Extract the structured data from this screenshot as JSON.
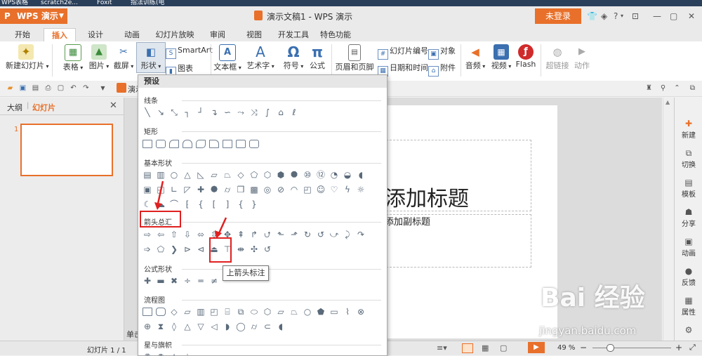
{
  "taskbar": {
    "items": [
      "WPS表格",
      "scratch2e...",
      "Foxit",
      "指法训练(电"
    ]
  },
  "app": {
    "name": "WPS 演示",
    "doc_title": "演示文稿1 - WPS 演示",
    "login": "未登录"
  },
  "tabs": [
    "开始",
    "插入",
    "设计",
    "动画",
    "幻灯片放映",
    "审阅",
    "视图",
    "开发工具",
    "特色功能"
  ],
  "ribbon": {
    "new_slide": "新建幻灯片",
    "table": "表格",
    "picture": "图片",
    "screenshot": "截屏",
    "shape": "形状",
    "smartart": "SmartArt",
    "chart": "图表",
    "textbox": "文本框",
    "wordart": "艺术字",
    "symbol": "符号",
    "formula": "公式",
    "header_footer": "页眉和页脚",
    "slide_number": "幻灯片编号",
    "object": "对象",
    "date_time": "日期和时间",
    "attachment": "附件",
    "audio": "音频",
    "video": "视频",
    "flash": "Flash",
    "hyperlink": "超链接",
    "action": "动作"
  },
  "quick_access": {
    "tab_label": "演示"
  },
  "left_panel": {
    "outline_tab": "大纲",
    "slides_tab": "幻灯片",
    "slide_num": "1"
  },
  "slide": {
    "title": "单击此处添加标题",
    "title_visible": "添加标题",
    "subtitle_visible": "添加副标题"
  },
  "right_sidebar": [
    "新建",
    "切换",
    "模板",
    "分享",
    "动画",
    "反馈",
    "属性"
  ],
  "status": {
    "slide_info": "幻灯片 1 / 1",
    "left_hint": "单击",
    "zoom": "49 %"
  },
  "dropdown": {
    "header": "预设",
    "categories": [
      "线条",
      "矩形",
      "基本形状",
      "箭头总汇",
      "公式形状",
      "流程图",
      "星与旗帜"
    ],
    "tooltip": "上箭头标注"
  },
  "watermark": {
    "text": "Bai 经验",
    "url": "jingyan.baidu.com"
  },
  "colors": {
    "accent": "#e8702a",
    "highlight": "#e02020"
  }
}
